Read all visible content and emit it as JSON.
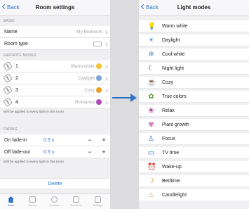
{
  "left": {
    "back_label": "Back",
    "title": "Room settings",
    "basic_header": "BASIC",
    "name_label": "Name",
    "name_value": "My Bedroom",
    "room_type_label": "Room type",
    "favorite_header": "FAVORITE MODES",
    "favorites": [
      {
        "num": "1",
        "mode": "Warm white",
        "icon": "bulb-icon",
        "color": "#f2c230"
      },
      {
        "num": "2",
        "mode": "Daylight",
        "icon": "sun-icon",
        "color": "#7aa6d8"
      },
      {
        "num": "3",
        "mode": "Cozy",
        "icon": "cozy-icon",
        "color": "#e8a020"
      },
      {
        "num": "4",
        "mode": "Romance",
        "icon": "romance-icon",
        "color": "#b04ab8"
      }
    ],
    "favorites_note": "Will be applied to every light in this room.",
    "fading_header": "FADING",
    "fade_in_label": "On fade-in",
    "fade_in_value": "0.5 s",
    "fade_out_label": "Off fade-out",
    "fade_out_value": "0.5 s",
    "minus": "−",
    "plus": "+",
    "fading_note": "Will be applied to every light in this room.",
    "delete_label": "Delete",
    "tabs": [
      "Home",
      "Scenes",
      "Routines",
      "Schedules",
      "Settings"
    ]
  },
  "right": {
    "back_label": "Back",
    "title": "Light modes",
    "modes": [
      {
        "label": "Warm white",
        "icon": "lightbulb-icon",
        "glyph": "💡",
        "color": "#e9b52a"
      },
      {
        "label": "Daylight",
        "icon": "sun-icon",
        "glyph": "☀",
        "color": "#5d8fcf"
      },
      {
        "label": "Cool white",
        "icon": "snowflake-icon",
        "glyph": "❄",
        "color": "#5d8fcf"
      },
      {
        "label": "Night light",
        "icon": "moon-icon",
        "glyph": "☾",
        "color": "#555"
      },
      {
        "label": "Cozy",
        "icon": "cozy-icon",
        "glyph": "☕",
        "color": "#d08a1a"
      },
      {
        "label": "True colors",
        "icon": "palette-icon",
        "glyph": "✿",
        "color": "#5a9a3a"
      },
      {
        "label": "Relax",
        "icon": "lotus-icon",
        "glyph": "❀",
        "color": "#b04a90"
      },
      {
        "label": "Plant growth",
        "icon": "plant-icon",
        "glyph": "✾",
        "color": "#c05ab0"
      },
      {
        "label": "Focus",
        "icon": "focus-icon",
        "glyph": "♙",
        "color": "#4a7ab8"
      },
      {
        "label": "TV time",
        "icon": "tv-icon",
        "glyph": "▭",
        "color": "#2d73c8"
      },
      {
        "label": "Wake-up",
        "icon": "wake-icon",
        "glyph": "⏰",
        "color": "#4a9ab0"
      },
      {
        "label": "Bedtime",
        "icon": "bed-icon",
        "glyph": "☽",
        "color": "#d08a1a"
      },
      {
        "label": "Candlelight",
        "icon": "candle-icon",
        "glyph": "♨",
        "color": "#d08a1a"
      }
    ]
  },
  "accent": "#2d73c8"
}
